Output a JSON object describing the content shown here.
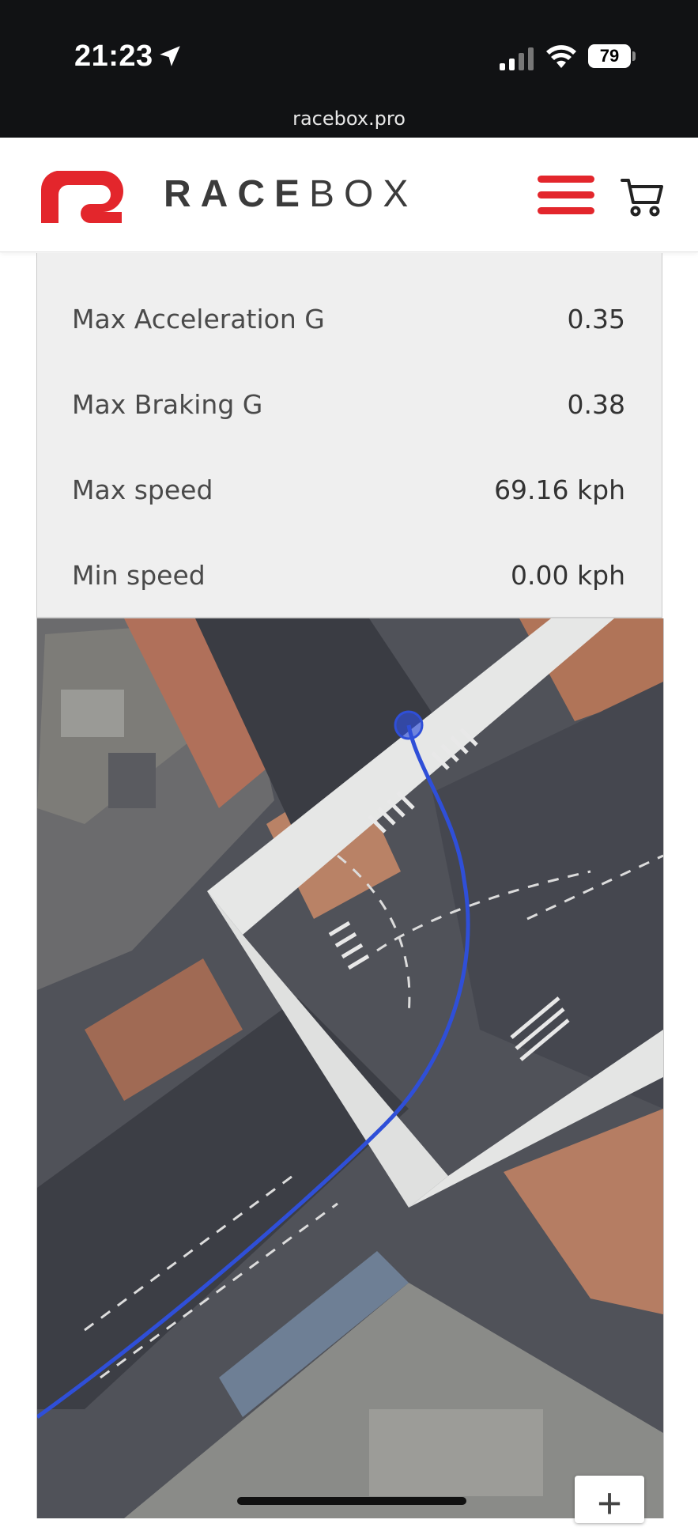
{
  "status_bar": {
    "time": "21:23",
    "battery": "79",
    "url": "racebox.pro"
  },
  "header": {
    "brand_bold": "RACE",
    "brand_light": "BOX",
    "accent_color": "#e3262c",
    "menu_icon": "hamburger-menu-icon",
    "cart_icon": "shopping-cart-icon"
  },
  "stats": [
    {
      "label": "Max Acceleration G",
      "value": "0.35"
    },
    {
      "label": "Max Braking G",
      "value": "0.38"
    },
    {
      "label": "Max speed",
      "value": "69.16 kph"
    },
    {
      "label": "Min speed",
      "value": "0.00 kph"
    }
  ],
  "map": {
    "type": "satellite",
    "route_color": "#2f4fd8",
    "zoom_in_label": "+"
  }
}
